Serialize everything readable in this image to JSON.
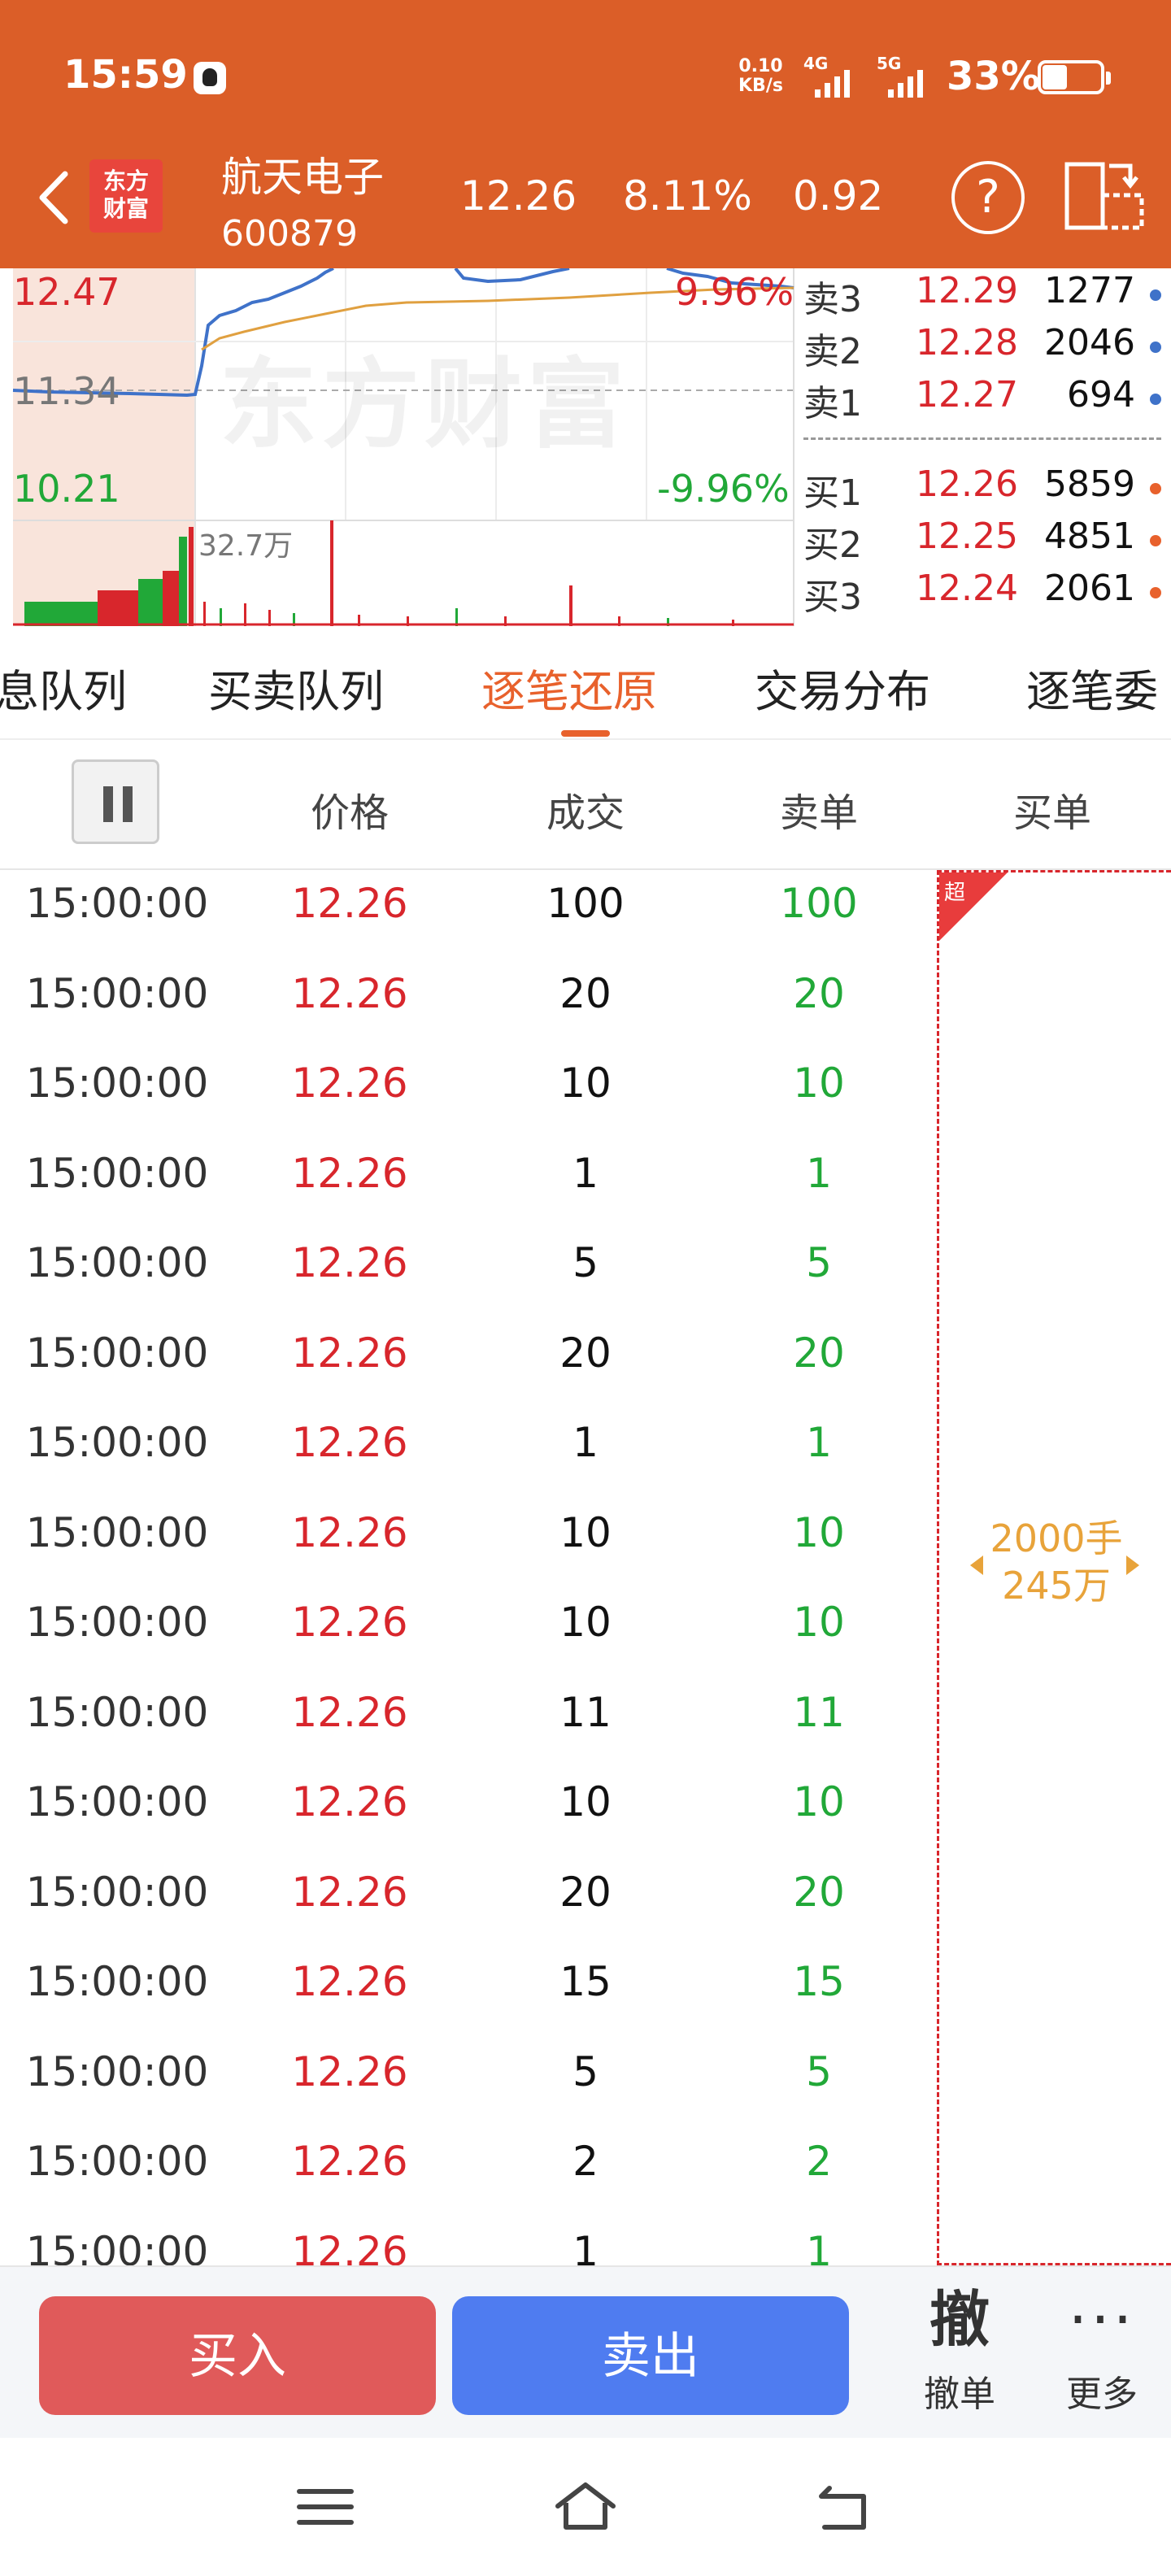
{
  "status_bar": {
    "time": "15:59",
    "net_speed_value": "0.10",
    "net_speed_unit": "KB/s",
    "sim1": "4G",
    "sim2": "5G",
    "battery": "33%"
  },
  "header": {
    "logo_text": "东方财富",
    "stock_name": "航天电子",
    "stock_code": "600879",
    "price": "12.26",
    "change_pct": "8.11%",
    "change_value": "0.92",
    "help_symbol": "?"
  },
  "chart": {
    "upper_price": "12.47",
    "upper_pct": "9.96%",
    "mid_price": "11.34",
    "lower_price": "10.21",
    "lower_pct": "-9.96%",
    "volume_label": "32.7万",
    "watermark": "东方财富"
  },
  "order_book": {
    "asks": [
      {
        "label": "卖3",
        "price": "12.29",
        "volume": "1277"
      },
      {
        "label": "卖2",
        "price": "12.28",
        "volume": "2046"
      },
      {
        "label": "卖1",
        "price": "12.27",
        "volume": "694"
      }
    ],
    "bids": [
      {
        "label": "买1",
        "price": "12.26",
        "volume": "5859"
      },
      {
        "label": "买2",
        "price": "12.25",
        "volume": "4851"
      },
      {
        "label": "买3",
        "price": "12.24",
        "volume": "2061"
      }
    ],
    "ask_dot_color": "#3F72C9",
    "bid_dot_color": "#E8612C"
  },
  "tabs": [
    "息队列",
    "买卖队列",
    "逐笔还原",
    "交易分布",
    "逐笔委"
  ],
  "active_tab": "逐笔还原",
  "table": {
    "headers": {
      "price": "价格",
      "deal": "成交",
      "sell": "卖单",
      "buy": "买单"
    },
    "rows": [
      {
        "time": "15:00:00",
        "price": "12.26",
        "deal": "100",
        "sell": "100"
      },
      {
        "time": "15:00:00",
        "price": "12.26",
        "deal": "20",
        "sell": "20"
      },
      {
        "time": "15:00:00",
        "price": "12.26",
        "deal": "10",
        "sell": "10"
      },
      {
        "time": "15:00:00",
        "price": "12.26",
        "deal": "1",
        "sell": "1"
      },
      {
        "time": "15:00:00",
        "price": "12.26",
        "deal": "5",
        "sell": "5"
      },
      {
        "time": "15:00:00",
        "price": "12.26",
        "deal": "20",
        "sell": "20"
      },
      {
        "time": "15:00:00",
        "price": "12.26",
        "deal": "1",
        "sell": "1"
      },
      {
        "time": "15:00:00",
        "price": "12.26",
        "deal": "10",
        "sell": "10"
      },
      {
        "time": "15:00:00",
        "price": "12.26",
        "deal": "10",
        "sell": "10"
      },
      {
        "time": "15:00:00",
        "price": "12.26",
        "deal": "11",
        "sell": "11"
      },
      {
        "time": "15:00:00",
        "price": "12.26",
        "deal": "10",
        "sell": "10"
      },
      {
        "time": "15:00:00",
        "price": "12.26",
        "deal": "20",
        "sell": "20"
      },
      {
        "time": "15:00:00",
        "price": "12.26",
        "deal": "15",
        "sell": "15"
      },
      {
        "time": "15:00:00",
        "price": "12.26",
        "deal": "5",
        "sell": "5"
      },
      {
        "time": "15:00:00",
        "price": "12.26",
        "deal": "2",
        "sell": "2"
      },
      {
        "time": "15:00:00",
        "price": "12.26",
        "deal": "1",
        "sell": "1"
      }
    ],
    "buy_order": {
      "badge": "超",
      "lots": "2000手",
      "amount": "245万"
    }
  },
  "bottom_bar": {
    "buy_label": "买入",
    "sell_label": "卖出",
    "cancel_icon": "撤",
    "cancel_label": "撤单",
    "more_icon": "···",
    "more_label": "更多"
  },
  "colors": {
    "brand_orange": "#DB5E28",
    "up_red": "#D8262C",
    "down_green": "#21A838",
    "active_tab": "#E8612C",
    "buy_button": "#E05A5A",
    "sell_button": "#4F7CF0",
    "big_order": "#E8A33A"
  }
}
